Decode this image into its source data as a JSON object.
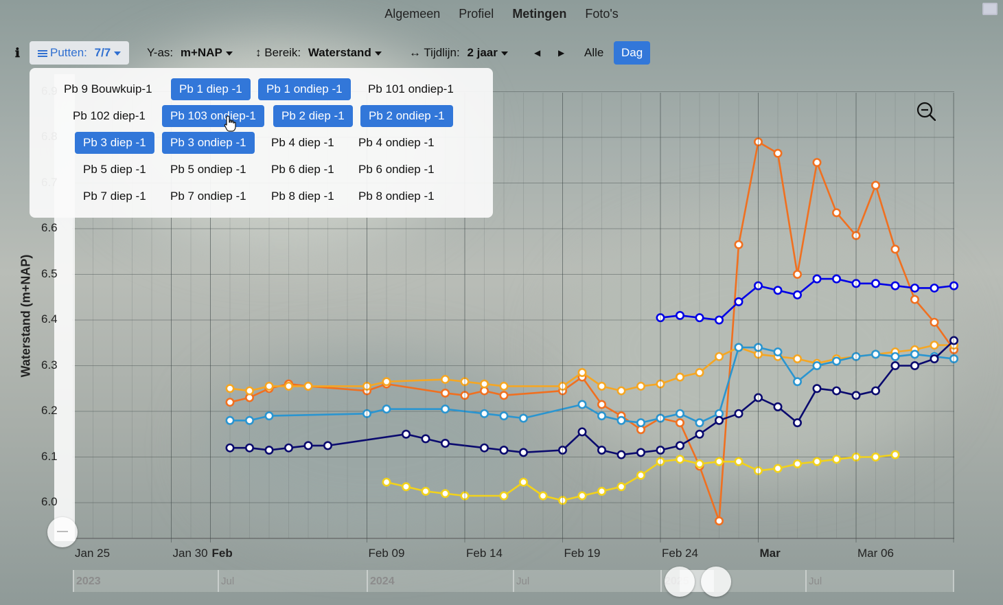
{
  "nav": {
    "items": [
      "Algemeen",
      "Profiel",
      "Metingen",
      "Foto's"
    ],
    "active": "Metingen"
  },
  "toolbar": {
    "info_icon": "info-icon",
    "putten_label": "Putten:",
    "putten_value": "7/7",
    "yas_label": "Y-as:",
    "yas_value": "m+NAP",
    "bereik_label": "Bereik:",
    "bereik_value": "Waterstand",
    "tijdlijn_label": "Tijdlijn:",
    "tijdlijn_value": "2 jaar",
    "alle_label": "Alle",
    "dag_label": "Dag"
  },
  "wells": {
    "items": [
      {
        "label": "Pb 9 Bouwkuip-1",
        "selected": false
      },
      {
        "label": "Pb 1 diep -1",
        "selected": true
      },
      {
        "label": "Pb 1 ondiep -1",
        "selected": true
      },
      {
        "label": "Pb 101 ondiep-1",
        "selected": false
      },
      {
        "label": "Pb 102 diep-1",
        "selected": false
      },
      {
        "label": "Pb 103 ondiep-1",
        "selected": true
      },
      {
        "label": "Pb 2 diep -1",
        "selected": true
      },
      {
        "label": "Pb 2 ondiep -1",
        "selected": true
      },
      {
        "label": "Pb 3 diep -1",
        "selected": true
      },
      {
        "label": "Pb 3 ondiep -1",
        "selected": true
      },
      {
        "label": "Pb 4 diep -1",
        "selected": false
      },
      {
        "label": "Pb 4 ondiep -1",
        "selected": false
      },
      {
        "label": "Pb 5 diep -1",
        "selected": false
      },
      {
        "label": "Pb 5 ondiep -1",
        "selected": false
      },
      {
        "label": "Pb 6 diep -1",
        "selected": false
      },
      {
        "label": "Pb 6 ondiep -1",
        "selected": false
      },
      {
        "label": "Pb 7 diep -1",
        "selected": false
      },
      {
        "label": "Pb 7 ondiep -1",
        "selected": false
      },
      {
        "label": "Pb 8 diep -1",
        "selected": false
      },
      {
        "label": "Pb 8 ondiep -1",
        "selected": false
      }
    ]
  },
  "overview": {
    "labels": [
      "2023",
      "Jul",
      "2024",
      "Jul",
      "2025",
      "Jul"
    ]
  },
  "chart_data": {
    "type": "line",
    "ylabel": "Waterstand (m+NAP)",
    "xlabel": "",
    "ylim": [
      5.92,
      6.92
    ],
    "xlim": [
      "2025-01-23",
      "2025-03-09"
    ],
    "y_ticks": [
      6.0,
      6.1,
      6.2,
      6.3,
      6.4,
      6.5,
      6.6,
      6.7,
      6.8,
      6.9
    ],
    "x_ticks": [
      {
        "date": "2025-01-25",
        "label": "Jan 25",
        "bold": false
      },
      {
        "date": "2025-01-30",
        "label": "Jan 30",
        "bold": false
      },
      {
        "date": "2025-02-01",
        "label": "Feb",
        "bold": true
      },
      {
        "date": "2025-02-09",
        "label": "Feb 09",
        "bold": false
      },
      {
        "date": "2025-02-14",
        "label": "Feb 14",
        "bold": false
      },
      {
        "date": "2025-02-19",
        "label": "Feb 19",
        "bold": false
      },
      {
        "date": "2025-02-24",
        "label": "Feb 24",
        "bold": false
      },
      {
        "date": "2025-03-01",
        "label": "Mar",
        "bold": true
      },
      {
        "date": "2025-03-06",
        "label": "Mar 06",
        "bold": false
      }
    ],
    "grid": true,
    "series": [
      {
        "color": "#f07020",
        "points": [
          [
            "2025-02-02",
            6.22
          ],
          [
            "2025-02-03",
            6.23
          ],
          [
            "2025-02-04",
            6.25
          ],
          [
            "2025-02-05",
            6.26
          ],
          [
            "2025-02-06",
            6.255
          ],
          [
            "2025-02-09",
            6.245
          ],
          [
            "2025-02-10",
            6.26
          ],
          [
            "2025-02-13",
            6.24
          ],
          [
            "2025-02-14",
            6.235
          ],
          [
            "2025-02-15",
            6.245
          ],
          [
            "2025-02-16",
            6.235
          ],
          [
            "2025-02-19",
            6.245
          ],
          [
            "2025-02-20",
            6.275
          ],
          [
            "2025-02-21",
            6.215
          ],
          [
            "2025-02-22",
            6.19
          ],
          [
            "2025-02-23",
            6.16
          ],
          [
            "2025-02-24",
            6.185
          ],
          [
            "2025-02-25",
            6.175
          ],
          [
            "2025-02-26",
            6.08
          ],
          [
            "2025-02-27",
            5.96
          ],
          [
            "2025-02-28",
            6.565
          ],
          [
            "2025-03-01",
            6.79
          ],
          [
            "2025-03-02",
            6.765
          ],
          [
            "2025-03-03",
            6.5
          ],
          [
            "2025-03-04",
            6.745
          ],
          [
            "2025-03-05",
            6.635
          ],
          [
            "2025-03-06",
            6.585
          ],
          [
            "2025-03-07",
            6.695
          ],
          [
            "2025-03-08",
            6.555
          ],
          [
            "2025-03-09",
            6.445
          ],
          [
            "2025-03-10",
            6.395
          ],
          [
            "2025-03-11",
            6.335
          ]
        ]
      },
      {
        "color": "#0000e6",
        "points": [
          [
            "2025-02-24",
            6.405
          ],
          [
            "2025-02-25",
            6.41
          ],
          [
            "2025-02-26",
            6.405
          ],
          [
            "2025-02-27",
            6.4
          ],
          [
            "2025-02-28",
            6.44
          ],
          [
            "2025-03-01",
            6.475
          ],
          [
            "2025-03-02",
            6.465
          ],
          [
            "2025-03-03",
            6.455
          ],
          [
            "2025-03-04",
            6.49
          ],
          [
            "2025-03-05",
            6.49
          ],
          [
            "2025-03-06",
            6.48
          ],
          [
            "2025-03-07",
            6.48
          ],
          [
            "2025-03-08",
            6.475
          ],
          [
            "2025-03-09",
            6.47
          ],
          [
            "2025-03-10",
            6.47
          ],
          [
            "2025-03-11",
            6.475
          ]
        ]
      },
      {
        "color": "#f5a623",
        "points": [
          [
            "2025-02-02",
            6.25
          ],
          [
            "2025-02-03",
            6.245
          ],
          [
            "2025-02-04",
            6.255
          ],
          [
            "2025-02-05",
            6.255
          ],
          [
            "2025-02-06",
            6.255
          ],
          [
            "2025-02-09",
            6.255
          ],
          [
            "2025-02-10",
            6.265
          ],
          [
            "2025-02-13",
            6.27
          ],
          [
            "2025-02-14",
            6.265
          ],
          [
            "2025-02-15",
            6.26
          ],
          [
            "2025-02-16",
            6.255
          ],
          [
            "2025-02-19",
            6.255
          ],
          [
            "2025-02-20",
            6.285
          ],
          [
            "2025-02-21",
            6.255
          ],
          [
            "2025-02-22",
            6.245
          ],
          [
            "2025-02-23",
            6.255
          ],
          [
            "2025-02-24",
            6.26
          ],
          [
            "2025-02-25",
            6.275
          ],
          [
            "2025-02-26",
            6.285
          ],
          [
            "2025-02-27",
            6.32
          ],
          [
            "2025-02-28",
            6.34
          ],
          [
            "2025-03-01",
            6.325
          ],
          [
            "2025-03-02",
            6.32
          ],
          [
            "2025-03-03",
            6.315
          ],
          [
            "2025-03-04",
            6.305
          ],
          [
            "2025-03-05",
            6.315
          ],
          [
            "2025-03-06",
            6.32
          ],
          [
            "2025-03-07",
            6.325
          ],
          [
            "2025-03-08",
            6.33
          ],
          [
            "2025-03-09",
            6.335
          ],
          [
            "2025-03-10",
            6.345
          ],
          [
            "2025-03-11",
            6.345
          ]
        ]
      },
      {
        "color": "#2a95d0",
        "points": [
          [
            "2025-02-02",
            6.18
          ],
          [
            "2025-02-03",
            6.18
          ],
          [
            "2025-02-04",
            6.19
          ],
          [
            "2025-02-09",
            6.195
          ],
          [
            "2025-02-10",
            6.205
          ],
          [
            "2025-02-13",
            6.205
          ],
          [
            "2025-02-15",
            6.195
          ],
          [
            "2025-02-16",
            6.19
          ],
          [
            "2025-02-17",
            6.185
          ],
          [
            "2025-02-20",
            6.215
          ],
          [
            "2025-02-21",
            6.19
          ],
          [
            "2025-02-22",
            6.18
          ],
          [
            "2025-02-23",
            6.175
          ],
          [
            "2025-02-24",
            6.185
          ],
          [
            "2025-02-25",
            6.195
          ],
          [
            "2025-02-26",
            6.175
          ],
          [
            "2025-02-27",
            6.195
          ],
          [
            "2025-02-28",
            6.34
          ],
          [
            "2025-03-01",
            6.34
          ],
          [
            "2025-03-02",
            6.33
          ],
          [
            "2025-03-03",
            6.265
          ],
          [
            "2025-03-04",
            6.3
          ],
          [
            "2025-03-05",
            6.31
          ],
          [
            "2025-03-06",
            6.32
          ],
          [
            "2025-03-07",
            6.325
          ],
          [
            "2025-03-08",
            6.32
          ],
          [
            "2025-03-09",
            6.325
          ],
          [
            "2025-03-10",
            6.32
          ],
          [
            "2025-03-11",
            6.315
          ]
        ]
      },
      {
        "color": "#0a0a6e",
        "points": [
          [
            "2025-02-02",
            6.12
          ],
          [
            "2025-02-03",
            6.12
          ],
          [
            "2025-02-04",
            6.115
          ],
          [
            "2025-02-05",
            6.12
          ],
          [
            "2025-02-06",
            6.125
          ],
          [
            "2025-02-07",
            6.125
          ],
          [
            "2025-02-11",
            6.15
          ],
          [
            "2025-02-12",
            6.14
          ],
          [
            "2025-02-13",
            6.13
          ],
          [
            "2025-02-15",
            6.12
          ],
          [
            "2025-02-16",
            6.115
          ],
          [
            "2025-02-17",
            6.11
          ],
          [
            "2025-02-19",
            6.115
          ],
          [
            "2025-02-20",
            6.155
          ],
          [
            "2025-02-21",
            6.115
          ],
          [
            "2025-02-22",
            6.105
          ],
          [
            "2025-02-23",
            6.11
          ],
          [
            "2025-02-24",
            6.115
          ],
          [
            "2025-02-25",
            6.125
          ],
          [
            "2025-02-26",
            6.15
          ],
          [
            "2025-02-27",
            6.18
          ],
          [
            "2025-02-28",
            6.195
          ],
          [
            "2025-03-01",
            6.23
          ],
          [
            "2025-03-02",
            6.21
          ],
          [
            "2025-03-03",
            6.175
          ],
          [
            "2025-03-04",
            6.25
          ],
          [
            "2025-03-05",
            6.245
          ],
          [
            "2025-03-06",
            6.235
          ],
          [
            "2025-03-07",
            6.245
          ],
          [
            "2025-03-08",
            6.3
          ],
          [
            "2025-03-09",
            6.3
          ],
          [
            "2025-03-10",
            6.315
          ],
          [
            "2025-03-11",
            6.355
          ]
        ]
      },
      {
        "color": "#f2d21b",
        "points": [
          [
            "2025-02-10",
            6.045
          ],
          [
            "2025-02-11",
            6.035
          ],
          [
            "2025-02-12",
            6.025
          ],
          [
            "2025-02-13",
            6.02
          ],
          [
            "2025-02-14",
            6.015
          ],
          [
            "2025-02-16",
            6.015
          ],
          [
            "2025-02-17",
            6.045
          ],
          [
            "2025-02-18",
            6.015
          ],
          [
            "2025-02-19",
            6.005
          ],
          [
            "2025-02-20",
            6.015
          ],
          [
            "2025-02-21",
            6.025
          ],
          [
            "2025-02-22",
            6.035
          ],
          [
            "2025-02-23",
            6.06
          ],
          [
            "2025-02-24",
            6.09
          ],
          [
            "2025-02-25",
            6.095
          ],
          [
            "2025-02-26",
            6.085
          ],
          [
            "2025-02-27",
            6.09
          ],
          [
            "2025-02-28",
            6.09
          ],
          [
            "2025-03-01",
            6.07
          ],
          [
            "2025-03-02",
            6.075
          ],
          [
            "2025-03-03",
            6.085
          ],
          [
            "2025-03-04",
            6.09
          ],
          [
            "2025-03-05",
            6.095
          ],
          [
            "2025-03-06",
            6.1
          ],
          [
            "2025-03-07",
            6.1
          ],
          [
            "2025-03-08",
            6.105
          ]
        ]
      }
    ]
  }
}
